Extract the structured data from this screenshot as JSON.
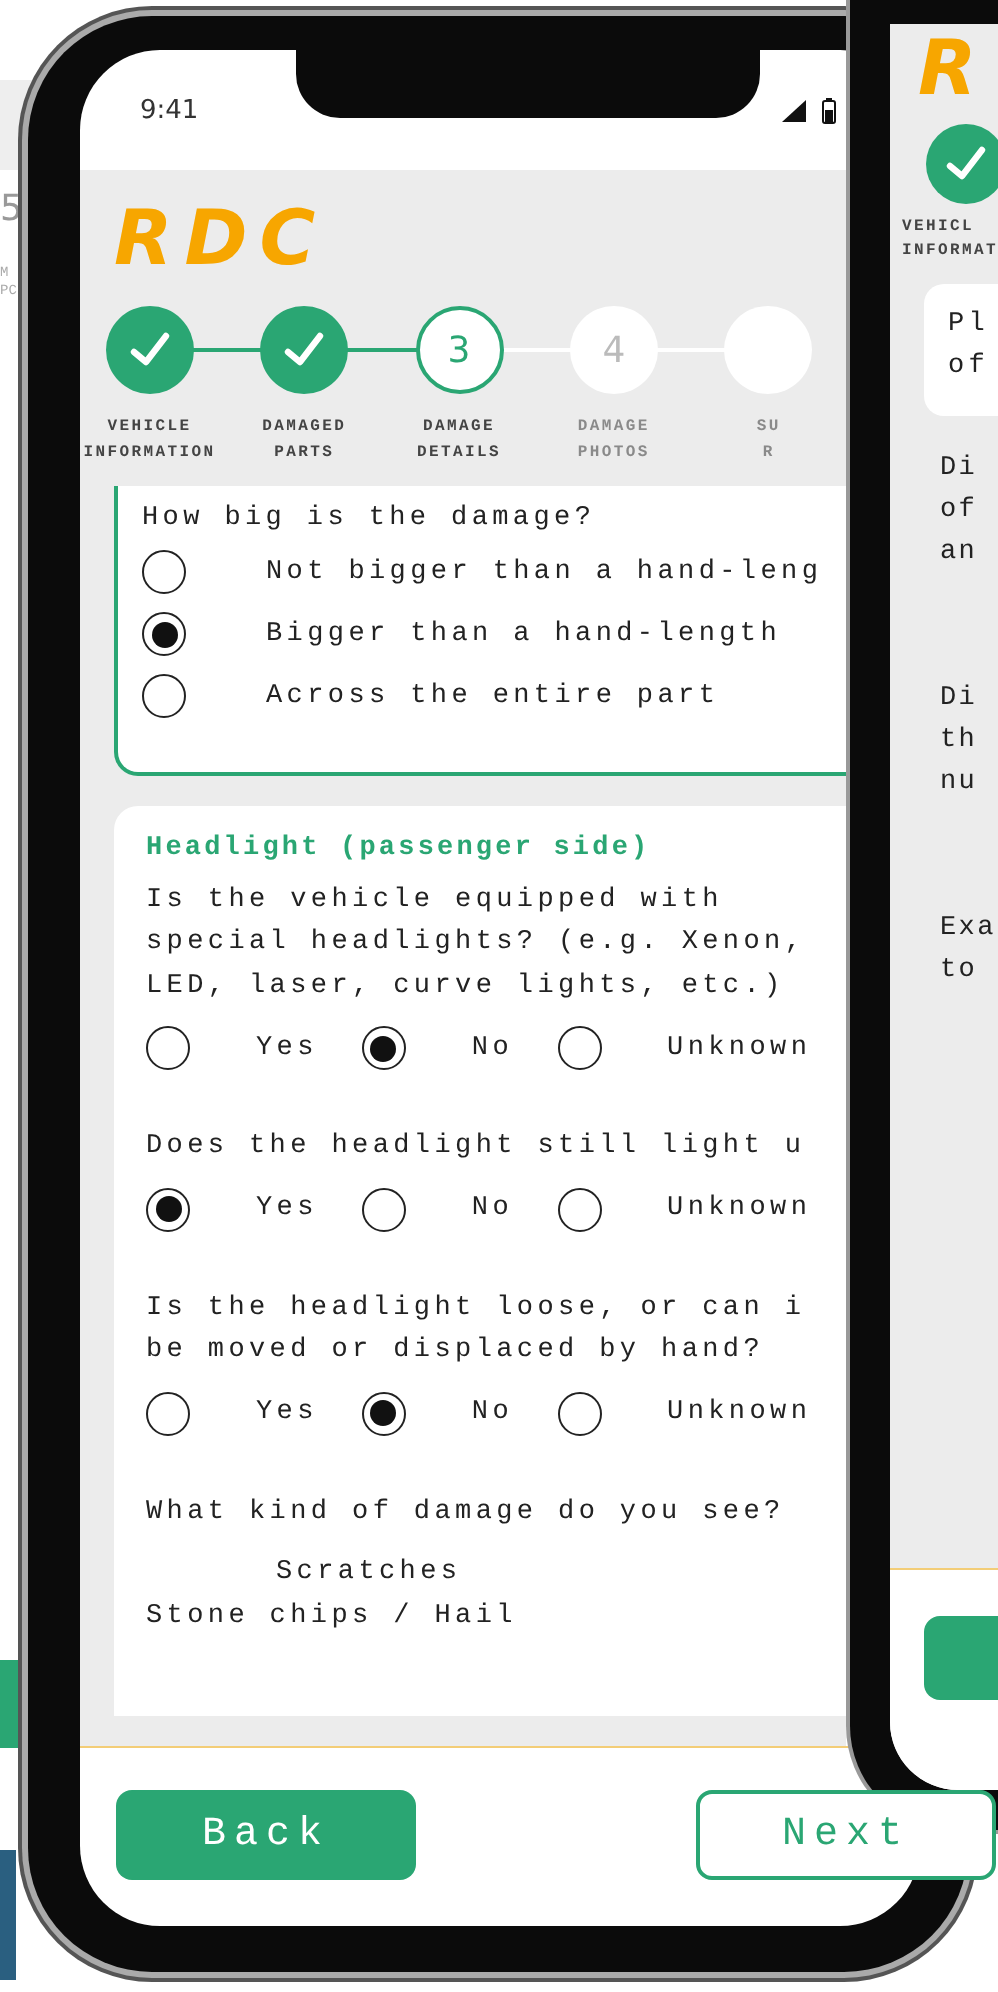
{
  "left_phone": {
    "page_number": "5",
    "labels": [
      "M",
      "PC"
    ]
  },
  "phone": {
    "status_bar": {
      "time": "9:41"
    },
    "logo": "RDC",
    "steps": [
      {
        "label": "VEHICLE\nINFORMATION",
        "completed": true,
        "selected": false
      },
      {
        "label": "DAMAGED\nPARTS",
        "completed": true,
        "selected": false
      },
      {
        "number": "3",
        "label": "DAMAGE\nDETAILS",
        "completed": false,
        "selected": true
      },
      {
        "number": "4",
        "label": "DAMAGE\nPHOTOS",
        "completed": false,
        "selected": false
      },
      {
        "label": "SU\nR",
        "completed": false,
        "selected": false
      }
    ],
    "size_card": {
      "question": "How big is the damage?",
      "options": [
        {
          "label": "Not bigger than a hand-leng",
          "selected": false
        },
        {
          "label": "Bigger than a hand-length",
          "selected": true
        },
        {
          "label": "Across the entire part",
          "selected": false
        }
      ]
    },
    "part_card": {
      "title": "Headlight (passenger side)",
      "questions": [
        {
          "kind": "radio",
          "text": "Is the vehicle equipped with\nspecial headlights? (e.g. Xenon,\nLED, laser, curve lights, etc.)",
          "options": [
            {
              "label": "Yes",
              "selected": false
            },
            {
              "label": "No",
              "selected": true
            },
            {
              "label": "Unknown",
              "selected": false
            }
          ]
        },
        {
          "kind": "radio",
          "text": "Does the headlight still light u",
          "options": [
            {
              "label": "Yes",
              "selected": true
            },
            {
              "label": "No",
              "selected": false
            },
            {
              "label": "Unknown",
              "selected": false
            }
          ]
        },
        {
          "kind": "radio",
          "text": "Is the headlight loose, or can i\nbe moved or displaced by hand?",
          "options": [
            {
              "label": "Yes",
              "selected": false
            },
            {
              "label": "No",
              "selected": true
            },
            {
              "label": "Unknown",
              "selected": false
            }
          ]
        },
        {
          "kind": "list",
          "text": "What kind of damage do you see?",
          "options": [
            {
              "label": "Scratches"
            },
            {
              "label": "Stone chips / Hail"
            }
          ]
        }
      ]
    },
    "buttons": [
      {
        "label": "Back",
        "kind": "primary"
      },
      {
        "label": "Next",
        "kind": "secondary"
      }
    ]
  },
  "second_phone": {
    "logo": "R",
    "step_label": "VEHICL\nINFORMAT",
    "card_text": "Pl\nof",
    "paragraphs": [
      "Di\nof\nan",
      "Di\nth\nnu",
      "Exa\nto"
    ]
  }
}
